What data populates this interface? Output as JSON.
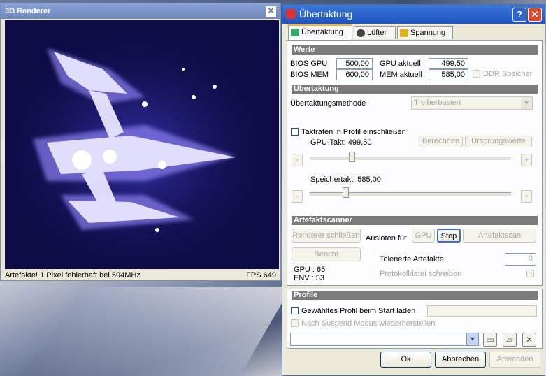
{
  "renderer": {
    "title": "3D Renderer",
    "status_left": "Artefakte! 1 Pixel fehlerhaft bei 594MHz",
    "status_right": "FPS 649"
  },
  "main": {
    "title": "Übertaktung",
    "tabs": [
      {
        "label": "Übertaktung",
        "icon": "gpu-card-icon"
      },
      {
        "label": "Lüfter",
        "icon": "fan-icon"
      },
      {
        "label": "Spannung",
        "icon": "voltage-icon"
      }
    ],
    "werte": {
      "heading": "Werte",
      "bios_gpu_label": "BIOS GPU",
      "bios_gpu_value": "500,00",
      "bios_mem_label": "BIOS MEM",
      "bios_mem_value": "600,00",
      "gpu_aktuell_label": "GPU aktuell",
      "gpu_aktuell_value": "499,50",
      "mem_aktuell_label": "MEM aktuell",
      "mem_aktuell_value": "585,00",
      "ddr_label": "DDR Speicher"
    },
    "uebertaktung": {
      "heading": "Übertaktung",
      "method_label": "Übertaktungsmethode",
      "method_value": "Treiberbasiert",
      "include_profile_label": "Taktraten in Profil einschließen",
      "berechnen": "Berechnen",
      "ursprungswerte": "Ursprungswerte",
      "gpu_takt_label": "GPU-Takt: 499,50",
      "gpu_takt_level": 0.2,
      "speichertakt_label": "Speichertakt: 585,00",
      "speichertakt_level": 0.17,
      "minus": "-",
      "plus": "+"
    },
    "artefakt": {
      "heading": "Artefaktscanner",
      "renderer_close": "Renderer schließen",
      "ausloten": "Ausloten für",
      "gpu_btn": "GPU",
      "stop_btn": "Stop",
      "scan_btn": "Artefaktscan",
      "bench_btn": "Bench!",
      "tolerierte_label": "Tolerierte Artefakte",
      "tolerierte_value": "0",
      "gpu_temp": "GPU : 65",
      "env_temp": "ENV : 53",
      "protokoll_label": "Protokolldatei schreiben"
    },
    "profile": {
      "heading": "Profile",
      "start_label": "Gewähltes Profil beim Start laden",
      "suspend_label": "Nach Suspend Modus wiederherstellen"
    },
    "buttons": {
      "ok": "Ok",
      "abbrechen": "Abbrechen",
      "anwenden": "Anwenden"
    }
  }
}
